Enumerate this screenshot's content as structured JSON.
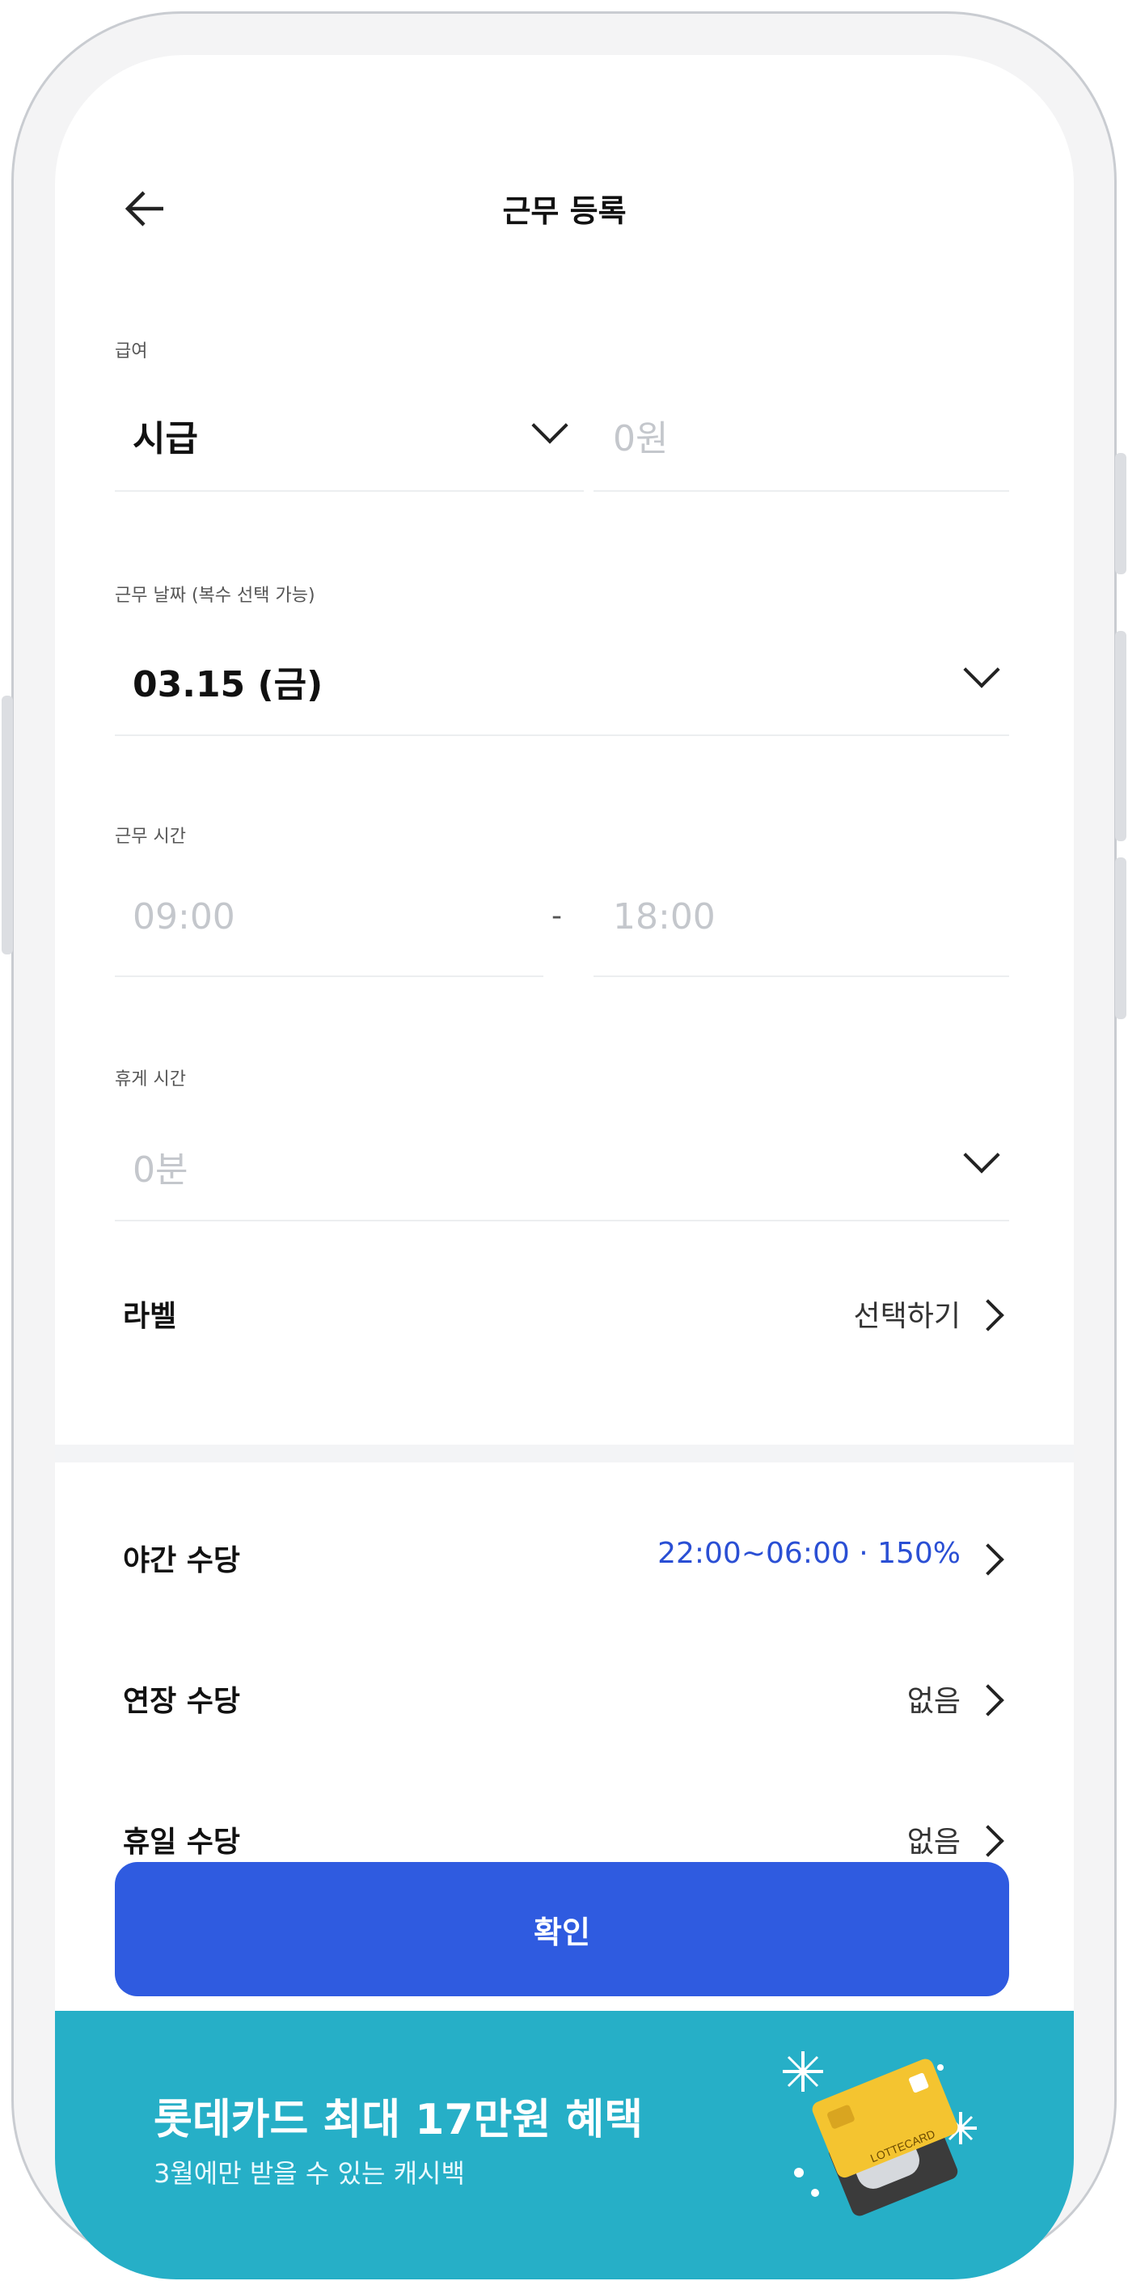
{
  "header": {
    "title": "근무 등록"
  },
  "pay": {
    "label": "급여",
    "type_value": "시급",
    "amount_placeholder": "0원"
  },
  "date": {
    "label": "근무 날짜 (복수 선택 가능)",
    "value": "03.15 (금)"
  },
  "work_time": {
    "label": "근무 시간",
    "start_placeholder": "09:00",
    "separator": "-",
    "end_placeholder": "18:00"
  },
  "break_time": {
    "label": "휴게 시간",
    "placeholder": "0분"
  },
  "label_row": {
    "label": "라벨",
    "value": "선택하기"
  },
  "allowances": [
    {
      "label": "야간 수당",
      "value": "22:00~06:00 · 150%",
      "value_color": "#2a4fd4"
    },
    {
      "label": "연장 수당",
      "value": "없음",
      "value_color": "#333333"
    },
    {
      "label": "휴일 수당",
      "value": "없음",
      "value_color": "#333333"
    }
  ],
  "confirm": {
    "label": "확인"
  },
  "banner": {
    "title": "롯데카드 최대 17만원 혜택",
    "subtitle": "3월에만 받을 수 있는 캐시백",
    "card_text": "LOTTECARD"
  },
  "colors": {
    "primary": "#2f5be0",
    "banner_bg": "#26afc7",
    "card_yellow": "#f4c430"
  },
  "icons": {
    "back": "arrow-left-icon",
    "dropdown": "chevron-down-icon",
    "next": "chevron-right-icon",
    "sparkle": "sparkle-icon"
  }
}
